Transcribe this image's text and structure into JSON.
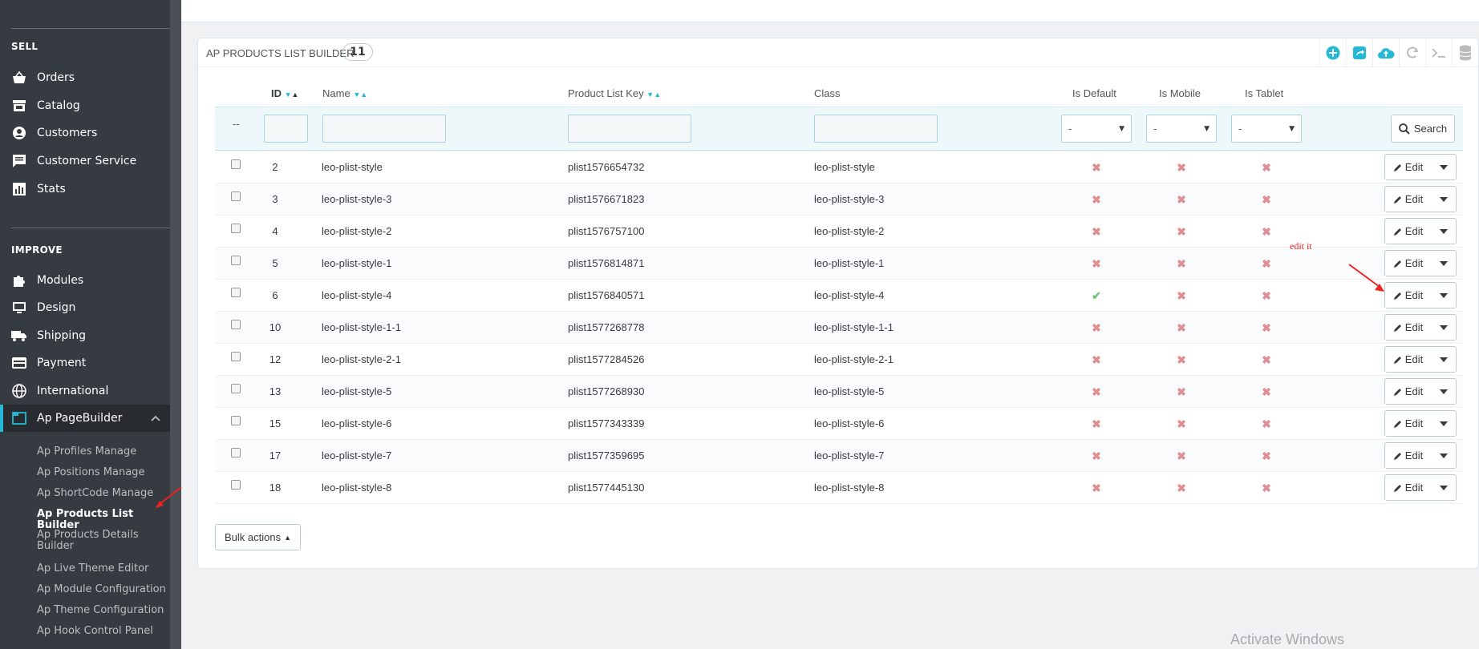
{
  "sidebar": {
    "sections": {
      "sell": "SELL",
      "improve": "IMPROVE"
    },
    "sell_items": [
      {
        "label": "Orders",
        "icon": "basket-icon"
      },
      {
        "label": "Catalog",
        "icon": "store-icon"
      },
      {
        "label": "Customers",
        "icon": "account-circle-icon"
      },
      {
        "label": "Customer Service",
        "icon": "chat-icon"
      },
      {
        "label": "Stats",
        "icon": "bar-chart-icon"
      }
    ],
    "improve_items": [
      {
        "label": "Modules",
        "icon": "puzzle-icon"
      },
      {
        "label": "Design",
        "icon": "desktop-icon"
      },
      {
        "label": "Shipping",
        "icon": "truck-icon"
      },
      {
        "label": "Payment",
        "icon": "credit-card-icon"
      },
      {
        "label": "International",
        "icon": "globe-icon"
      },
      {
        "label": "Ap PageBuilder",
        "icon": "window-icon"
      }
    ],
    "sub_items": [
      "Ap Profiles Manage",
      "Ap Positions Manage",
      "Ap ShortCode Manage",
      "Ap Products List Builder",
      "Ap Products Details Builder",
      "Ap Live Theme Editor",
      "Ap Module Configuration",
      "Ap Theme Configuration",
      "Ap Hook Control Panel"
    ]
  },
  "panel": {
    "title": "AP PRODUCTS LIST BUILDER",
    "count": "11"
  },
  "table": {
    "headers": {
      "id": "ID",
      "name": "Name",
      "key": "Product List Key",
      "class": "Class",
      "is_default": "Is Default",
      "is_mobile": "Is Mobile",
      "is_tablet": "Is Tablet"
    },
    "filter": {
      "dash": "--",
      "select_value": "-",
      "search_label": "Search"
    },
    "rows": [
      {
        "id": "2",
        "name": "leo-plist-style",
        "key": "plist1576654732",
        "class": "leo-plist-style",
        "default": false
      },
      {
        "id": "3",
        "name": "leo-plist-style-3",
        "key": "plist1576671823",
        "class": "leo-plist-style-3",
        "default": false
      },
      {
        "id": "4",
        "name": "leo-plist-style-2",
        "key": "plist1576757100",
        "class": "leo-plist-style-2",
        "default": false
      },
      {
        "id": "5",
        "name": "leo-plist-style-1",
        "key": "plist1576814871",
        "class": "leo-plist-style-1",
        "default": false
      },
      {
        "id": "6",
        "name": "leo-plist-style-4",
        "key": "plist1576840571",
        "class": "leo-plist-style-4",
        "default": true
      },
      {
        "id": "10",
        "name": "leo-plist-style-1-1",
        "key": "plist1577268778",
        "class": "leo-plist-style-1-1",
        "default": false
      },
      {
        "id": "12",
        "name": "leo-plist-style-2-1",
        "key": "plist1577284526",
        "class": "leo-plist-style-2-1",
        "default": false
      },
      {
        "id": "13",
        "name": "leo-plist-style-5",
        "key": "plist1577268930",
        "class": "leo-plist-style-5",
        "default": false
      },
      {
        "id": "15",
        "name": "leo-plist-style-6",
        "key": "plist1577343339",
        "class": "leo-plist-style-6",
        "default": false
      },
      {
        "id": "17",
        "name": "leo-plist-style-7",
        "key": "plist1577359695",
        "class": "leo-plist-style-7",
        "default": false
      },
      {
        "id": "18",
        "name": "leo-plist-style-8",
        "key": "plist1577445130",
        "class": "leo-plist-style-8",
        "default": false
      }
    ],
    "edit_label": "Edit"
  },
  "bulk_actions": "Bulk actions",
  "annotation": "edit it",
  "watermark": "Activate Windows",
  "colors": {
    "accent": "#25b9d7",
    "sidebar": "#363a41",
    "false_mark": "#e08f95",
    "true_mark": "#72c279"
  }
}
